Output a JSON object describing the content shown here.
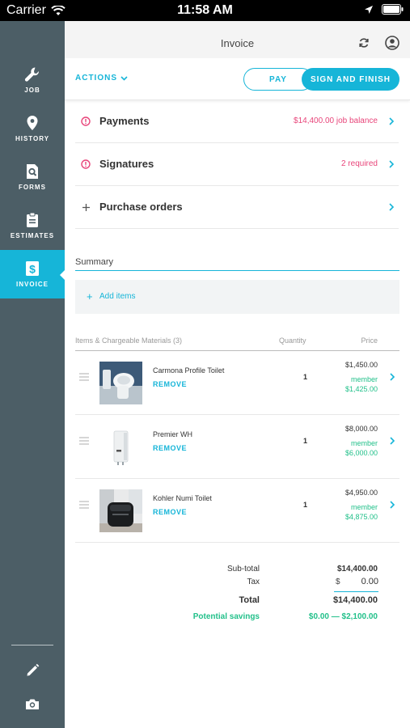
{
  "status_bar": {
    "carrier": "Carrier",
    "time": "11:58 AM"
  },
  "sidebar": {
    "items": [
      {
        "label": "JOB",
        "icon": "wrench-icon"
      },
      {
        "label": "HISTORY",
        "icon": "location-pin-icon"
      },
      {
        "label": "FORMS",
        "icon": "form-search-icon"
      },
      {
        "label": "ESTIMATES",
        "icon": "clipboard-icon"
      },
      {
        "label": "INVOICE",
        "icon": "invoice-dollar-icon",
        "active": true
      }
    ],
    "tools": [
      "pencil-icon",
      "camera-icon"
    ]
  },
  "header": {
    "title": "Invoice"
  },
  "actionbar": {
    "actions_label": "ACTIONS",
    "pay_label": "PAY",
    "sign_label": "SIGN AND FINISH"
  },
  "rows": [
    {
      "title": "Payments",
      "status": "$14,400.00 job balance",
      "icon": "alert-circle-icon"
    },
    {
      "title": "Signatures",
      "status": "2 required",
      "icon": "alert-circle-icon"
    },
    {
      "title": "Purchase orders",
      "status": "",
      "icon": "plus-icon"
    }
  ],
  "summary": {
    "title": "Summary",
    "add_items": "Add items"
  },
  "table": {
    "headers": {
      "items": "Items & Chargeable Materials (3)",
      "quantity": "Quantity",
      "price": "Price"
    },
    "items": [
      {
        "name": "Carmona Profile Toilet",
        "remove": "REMOVE",
        "qty": "1",
        "price": "$1,450.00",
        "member_label": "member",
        "member_price": "$1,425.00"
      },
      {
        "name": "Premier WH",
        "remove": "REMOVE",
        "qty": "1",
        "price": "$8,000.00",
        "member_label": "member",
        "member_price": "$6,000.00"
      },
      {
        "name": "Kohler Numi Toilet",
        "remove": "REMOVE",
        "qty": "1",
        "price": "$4,950.00",
        "member_label": "member",
        "member_price": "$4,875.00"
      }
    ]
  },
  "totals": {
    "subtotal_label": "Sub-total",
    "subtotal": "$14,400.00",
    "tax_label": "Tax",
    "tax_currency": "$",
    "tax": "0.00",
    "total_label": "Total",
    "total": "$14,400.00",
    "savings_label": "Potential savings",
    "savings": "$0.00 — $2,100.00"
  },
  "colors": {
    "accent": "#16b5d8",
    "sidebar": "#4c5e66",
    "alert": "#e8457a",
    "savings": "#22c08a"
  }
}
